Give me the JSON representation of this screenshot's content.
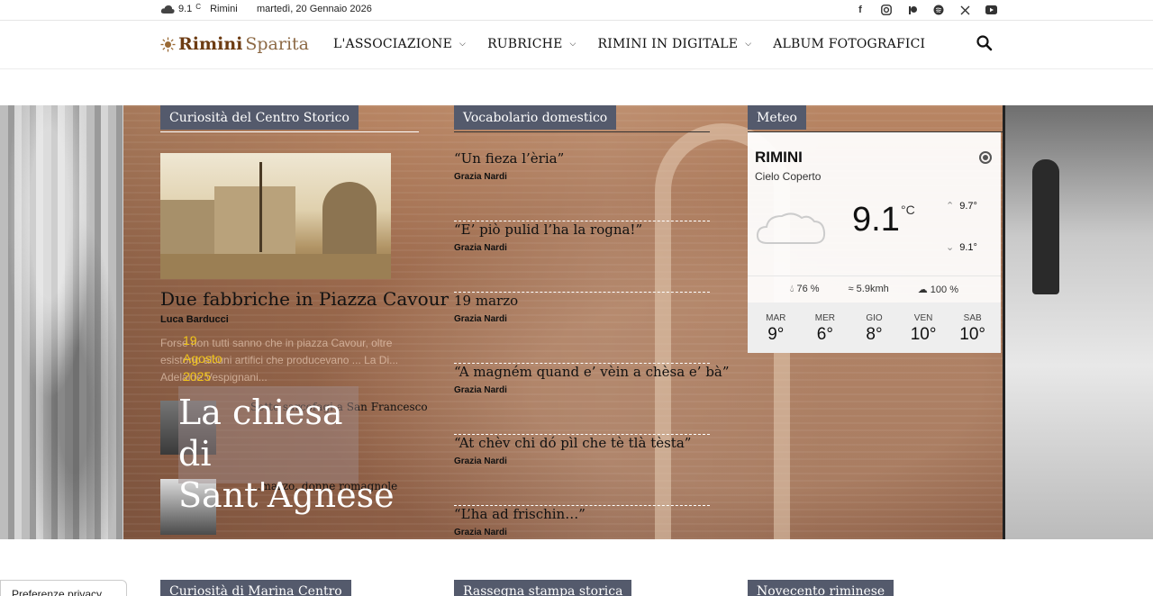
{
  "topbar": {
    "weather_temp": "9.1",
    "weather_unit": "C",
    "weather_city": "Rimini",
    "date": "martedì, 20 Gennaio 2026",
    "social_icons": [
      "facebook-icon",
      "instagram-icon",
      "patreon-icon",
      "spotify-icon",
      "x-icon",
      "youtube-icon"
    ]
  },
  "header": {
    "logo_part1": "Rimini",
    "logo_part2": "Sparita",
    "nav": [
      {
        "label": "L'ASSOCIAZIONE",
        "has_dropdown": true
      },
      {
        "label": "RUBRICHE",
        "has_dropdown": true
      },
      {
        "label": "RIMINI IN DIGITALE",
        "has_dropdown": true
      },
      {
        "label": "ALBUM FOTOGRAFICI",
        "has_dropdown": false
      }
    ]
  },
  "col1": {
    "title": "Curiosità del Centro Storico",
    "main_title": "Due fabbriche in Piazza Cavour",
    "main_author": "Luca Barducci",
    "main_excerpt": "Forse non tutti sanno che in piazza Cavour, oltre esistono alcuni artifici che producevano ... La Di... Adelaide Vespignani...",
    "overlay_date_day": "19",
    "overlay_date_month": "Agosto",
    "overlay_date_year": "2025",
    "overlay_title": "La chiesa di Sant'Agnese",
    "small1_title": "Sette sarcofagi a San Francesco",
    "small2_title": "...marzo, donne romagnole"
  },
  "col2": {
    "title": "Vocabolario domestico",
    "items": [
      {
        "title": "“Un fieza l’èria”",
        "author": "Grazia Nardi"
      },
      {
        "title": "“E’ piò pulid l’ha la rogna!”",
        "author": "Grazia Nardi"
      },
      {
        "title": "19 marzo",
        "author": "Grazia Nardi"
      },
      {
        "title": "“A magném quand e’ vèin a chèsa e’ bà”",
        "author": "Grazia Nardi"
      },
      {
        "title": "“At chèv chi dó pìl che tè tlà tèsta”",
        "author": "Grazia Nardi"
      },
      {
        "title": "“L’ha ad frischin…”",
        "author": "Grazia Nardi"
      }
    ]
  },
  "col3": {
    "title": "Meteo",
    "city": "RIMINI",
    "description": "Cielo Coperto",
    "temp": "9.1",
    "unit": "°C",
    "high": "9.7°",
    "low": "9.1°",
    "humidity": "76 %",
    "wind": "5.9kmh",
    "clouds": "100 %",
    "forecast": [
      {
        "day": "MAR",
        "temp": "9°"
      },
      {
        "day": "MER",
        "temp": "6°"
      },
      {
        "day": "GIO",
        "temp": "8°"
      },
      {
        "day": "VEN",
        "temp": "10°"
      },
      {
        "day": "SAB",
        "temp": "10°"
      }
    ]
  },
  "bottom": {
    "privacy": "Preferenze privacy",
    "section1": "Curiosità di Marina Centro",
    "section2": "Rassegna stampa storica",
    "section3": "Novecento riminese"
  }
}
